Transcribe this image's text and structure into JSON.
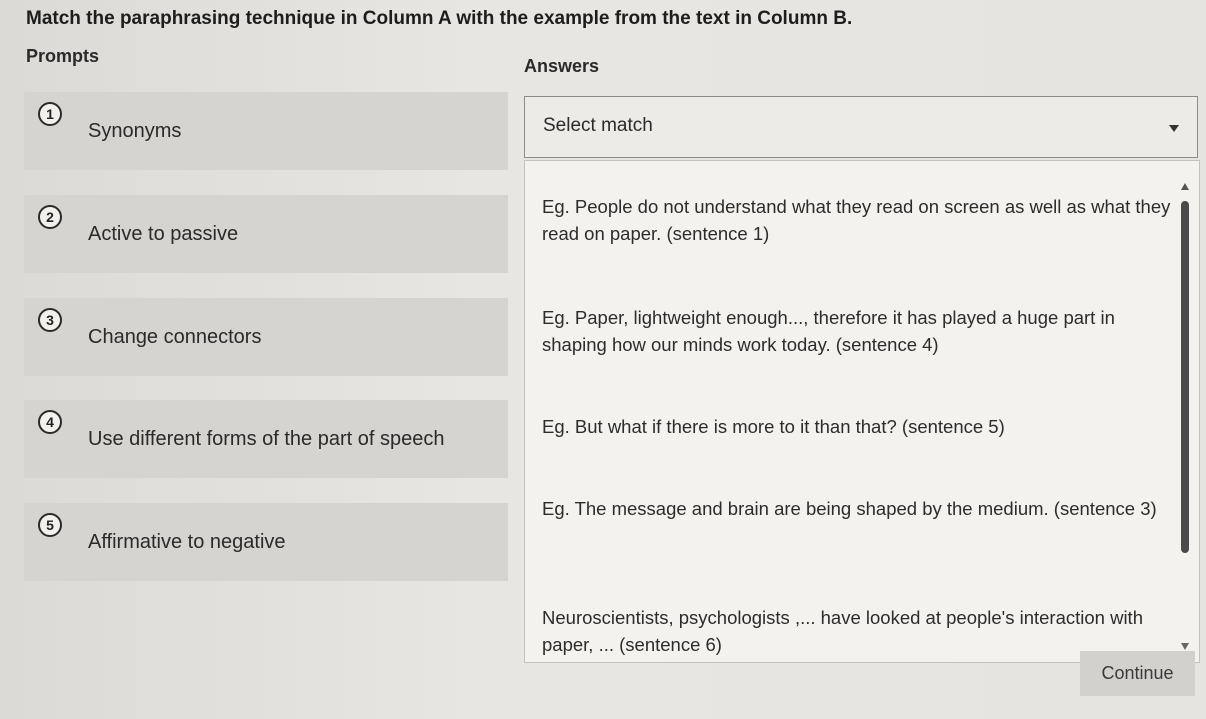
{
  "instruction": "Match the paraphrasing technique in Column A with the example from the text in Column B.",
  "prompts_header": "Prompts",
  "answers_header": "Answers",
  "prompts": [
    {
      "number": "1",
      "label": "Synonyms"
    },
    {
      "number": "2",
      "label": "Active to passive"
    },
    {
      "number": "3",
      "label": "Change connectors"
    },
    {
      "number": "4",
      "label": "Use different forms of the part of speech"
    },
    {
      "number": "5",
      "label": "Affirmative to negative"
    }
  ],
  "select": {
    "value": "Select match",
    "icon": "chevron-down-icon"
  },
  "options": [
    "Eg. People do not understand what they read on screen as well as what they read on paper. (sentence 1)",
    "Eg. Paper, lightweight enough..., therefore it has played a huge part in shaping how our minds work today. (sentence 4)",
    "Eg. But what if there is more to it than that? (sentence 5)",
    "Eg. The message and brain are being shaped by the medium. (sentence 3)",
    "Neuroscientists, psychologists ,... have looked at people's interaction with paper, ... (sentence 6)"
  ],
  "continue_label": "Continue"
}
